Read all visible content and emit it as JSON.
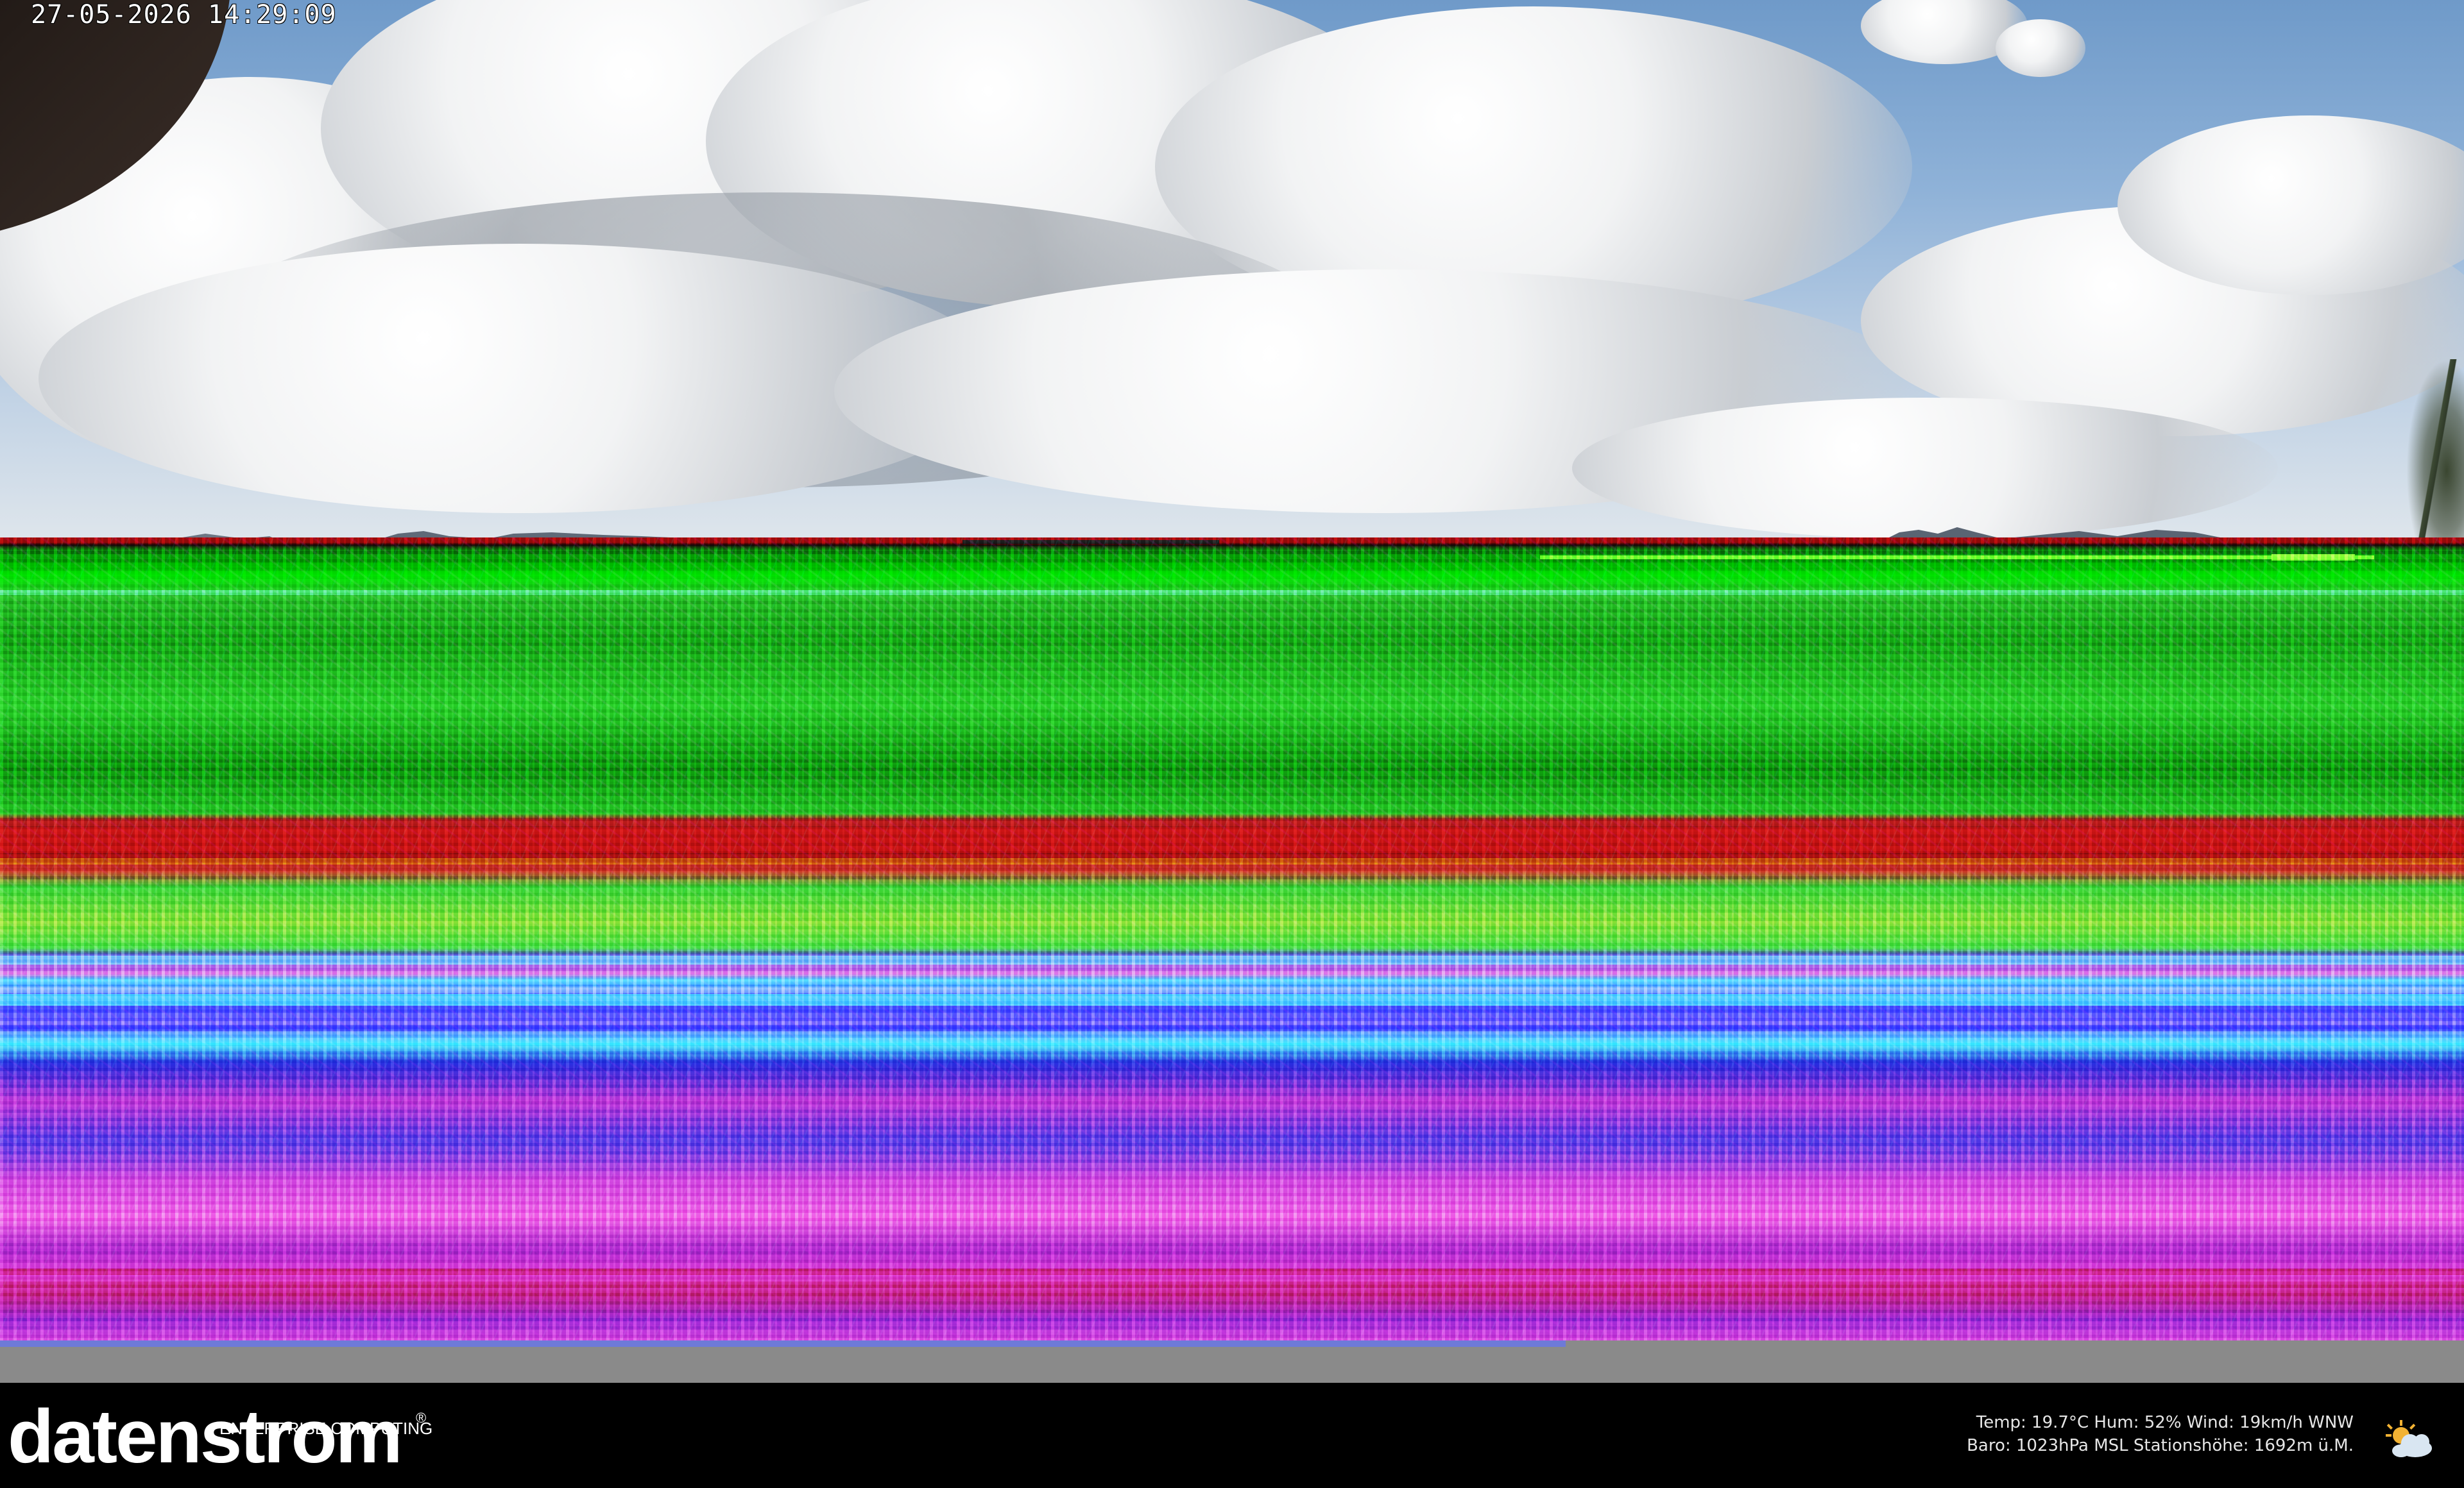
{
  "overlay": {
    "timestamp": "27-05-2026 14:29:09"
  },
  "branding": {
    "logo_main": "datenstrom",
    "logo_tagline": "ENTERPRISE COMPUTING",
    "logo_registered": "®"
  },
  "weather": {
    "line1": "Temp: 19.7°C  Hum: 52%  Wind: 19km/h WNW",
    "line2": "Baro: 1023hPa MSL  Stationshöhe: 1692m ü.M.",
    "icon": "partly-cloudy-icon"
  },
  "colors": {
    "sky_top": "#6f9ac9",
    "bar_background": "#000000",
    "grey_strip": "#8a8a8a",
    "glitch_green": "#00e600",
    "glitch_magenta": "#d84ae0"
  }
}
